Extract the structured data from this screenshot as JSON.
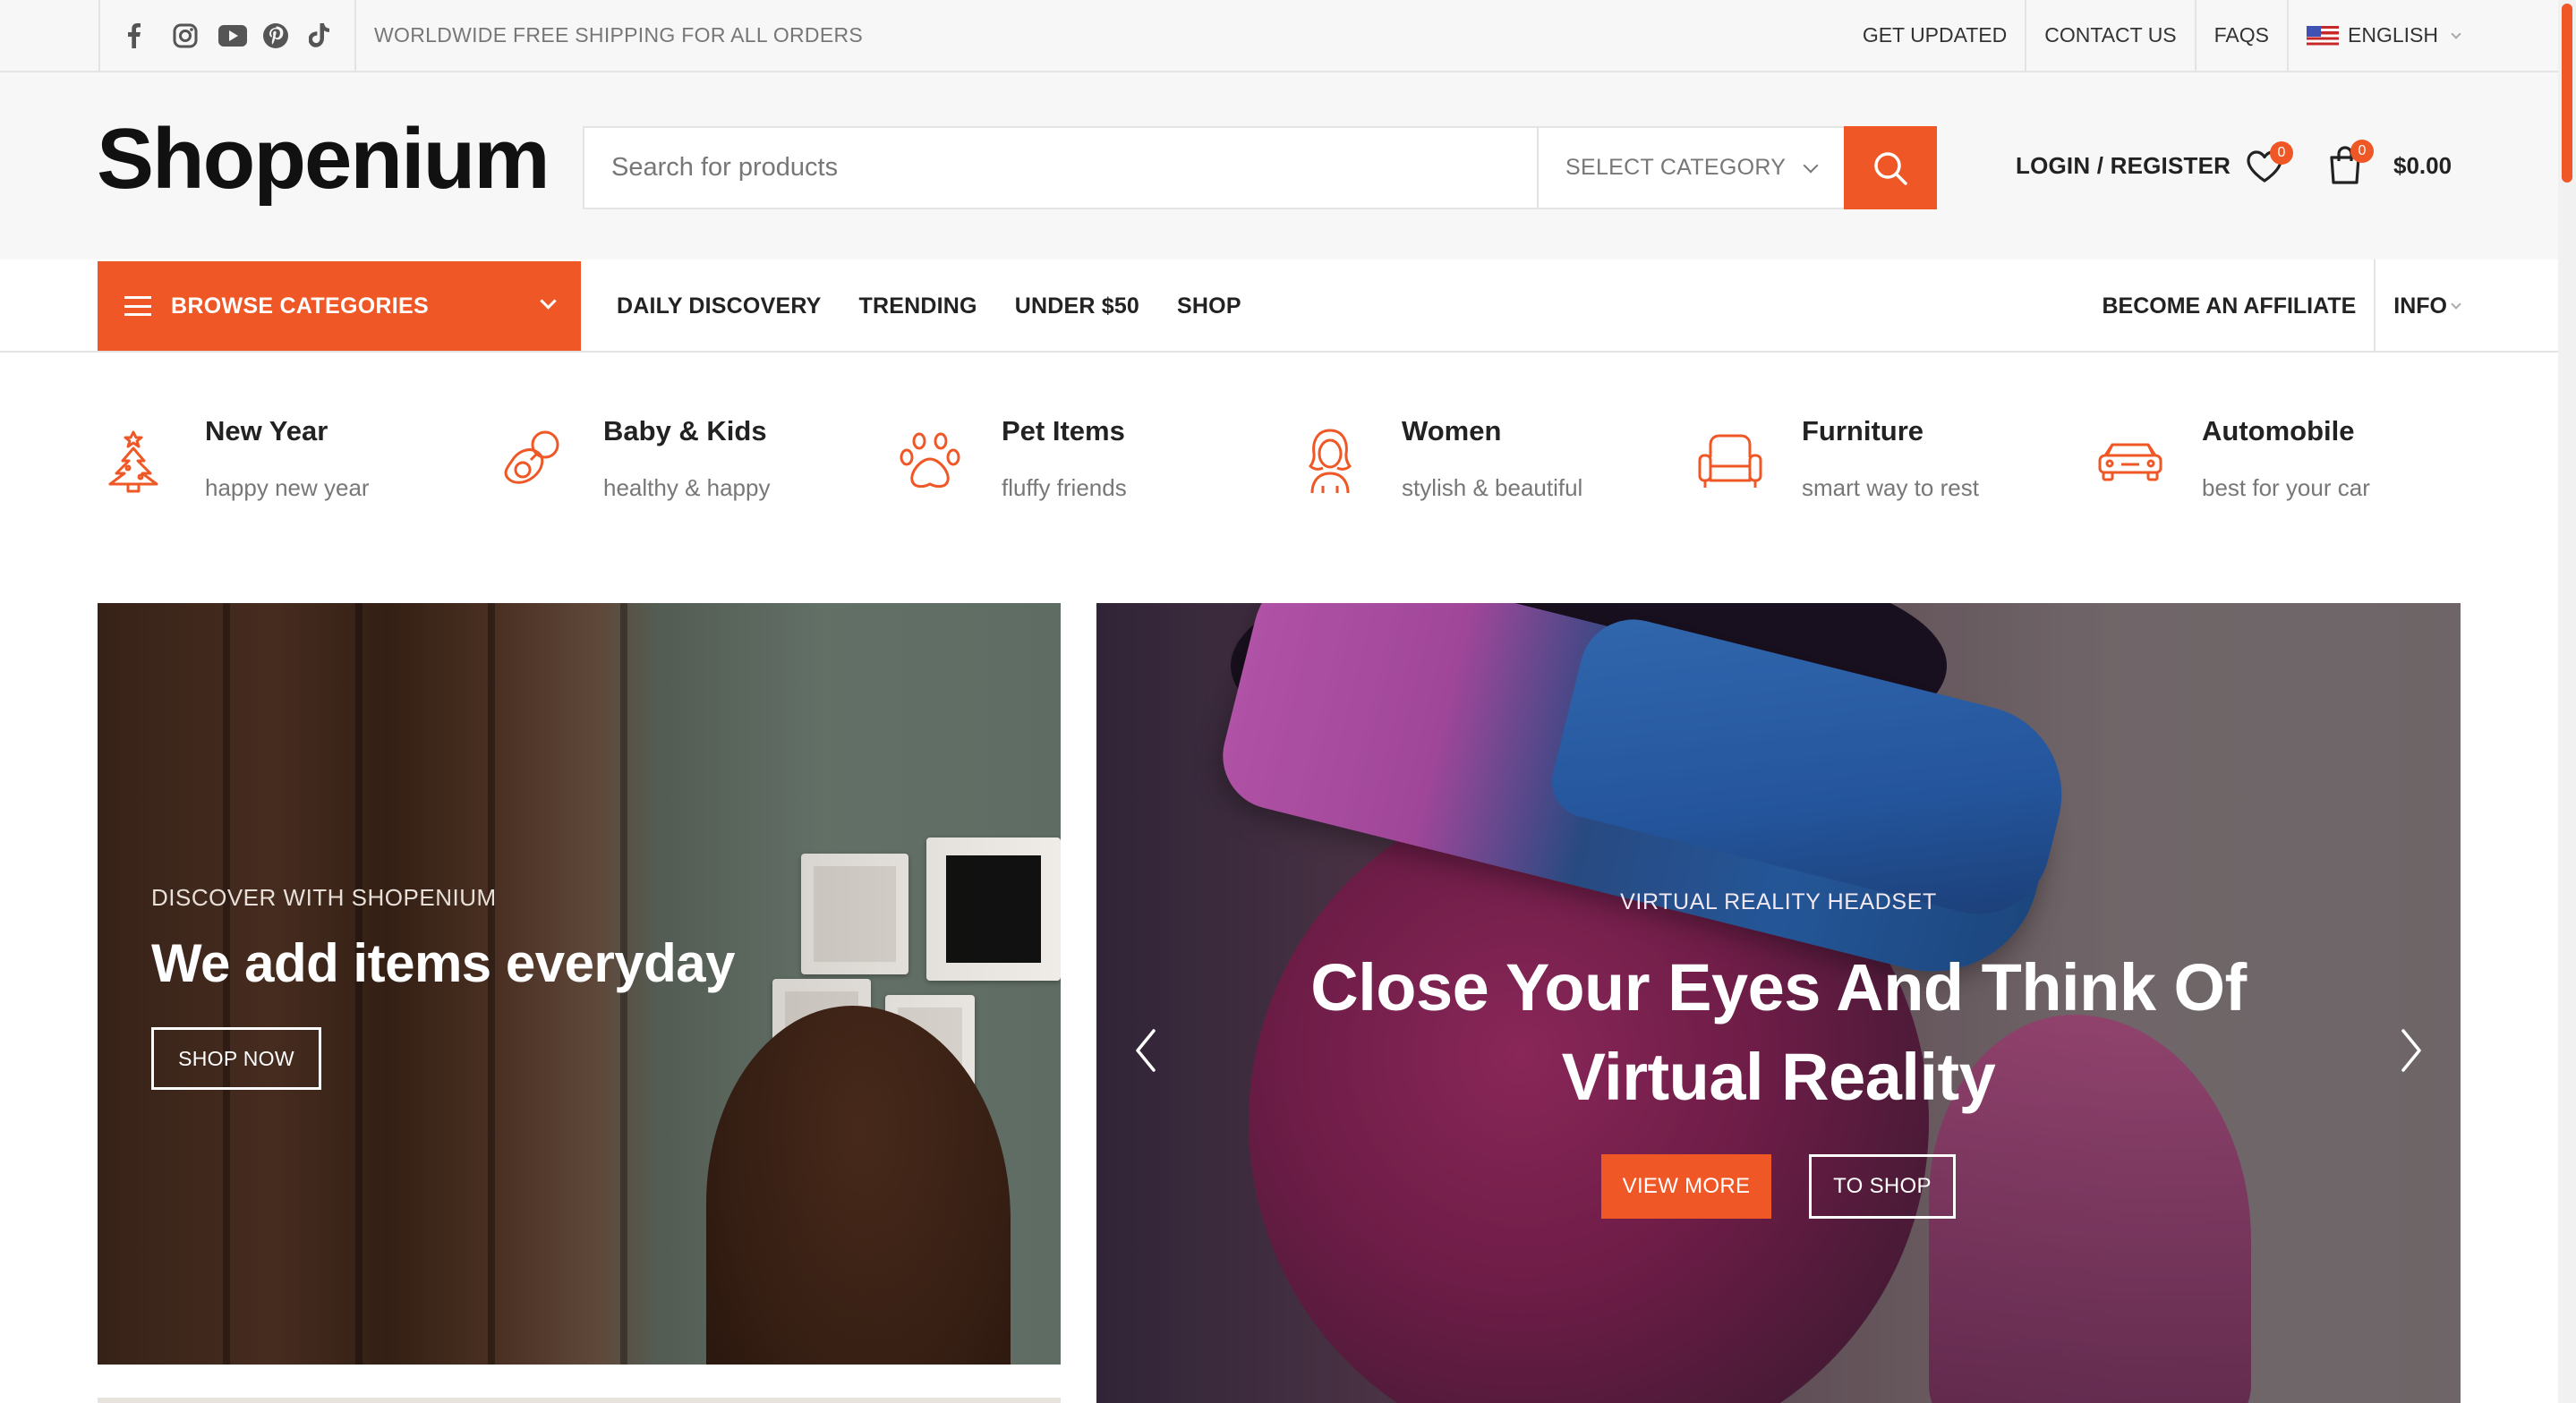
{
  "topbar": {
    "social_icons": [
      "facebook-icon",
      "instagram-icon",
      "youtube-icon",
      "pinterest-icon",
      "tiktok-icon"
    ],
    "shipping_text": "WORLDWIDE FREE SHIPPING FOR ALL ORDERS",
    "links": [
      "GET UPDATED",
      "CONTACT US",
      "FAQS"
    ],
    "language": "ENGLISH"
  },
  "header": {
    "logo": "Shopenium",
    "search_placeholder": "Search for products",
    "category_select": "SELECT CATEGORY",
    "login_label": "LOGIN / REGISTER",
    "wishlist_count": "0",
    "cart_count": "0",
    "cart_total": "$0.00"
  },
  "nav": {
    "browse_label": "BROWSE CATEGORIES",
    "links": [
      "DAILY DISCOVERY",
      "TRENDING",
      "UNDER $50",
      "SHOP"
    ],
    "affiliate_label": "BECOME AN AFFILIATE",
    "info_label": "INFO"
  },
  "categories": [
    {
      "title": "New Year",
      "subtitle": "happy new year",
      "icon": "christmas-tree-icon"
    },
    {
      "title": "Baby & Kids",
      "subtitle": "healthy & happy",
      "icon": "pacifier-icon"
    },
    {
      "title": "Pet Items",
      "subtitle": "fluffy friends",
      "icon": "paw-icon"
    },
    {
      "title": "Women",
      "subtitle": "stylish & beautiful",
      "icon": "woman-icon"
    },
    {
      "title": "Furniture",
      "subtitle": "smart way to rest",
      "icon": "armchair-icon"
    },
    {
      "title": "Automobile",
      "subtitle": "best for your car",
      "icon": "car-icon"
    }
  ],
  "banner_left": {
    "kicker": "DISCOVER WITH SHOPENIUM",
    "title": "We add items everyday",
    "button": "SHOP NOW"
  },
  "banner_right": {
    "kicker": "VIRTUAL REALITY HEADSET",
    "title_line1": "Close Your Eyes And Think Of",
    "title_line2": "Virtual Reality",
    "button_primary": "VIEW MORE",
    "button_secondary": "TO SHOP"
  },
  "colors": {
    "accent": "#ef5826",
    "text": "#242424",
    "muted": "#777777",
    "topbar_bg": "#f7f7f7"
  }
}
